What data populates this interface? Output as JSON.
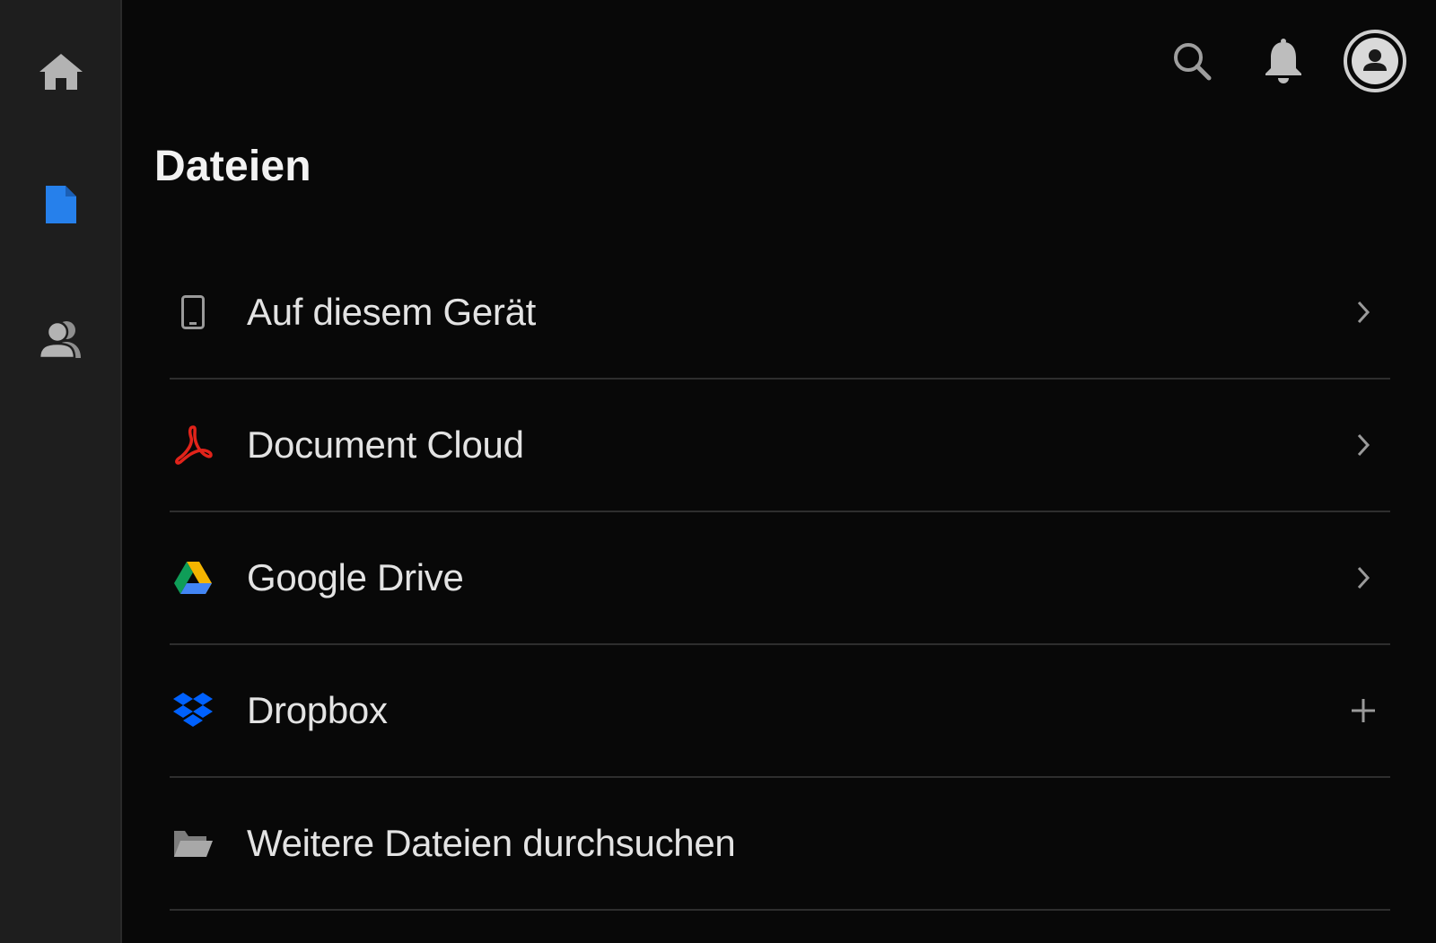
{
  "header": {
    "title": "Dateien",
    "icons": [
      "search-icon",
      "bell-icon",
      "account-icon"
    ]
  },
  "sidebar": {
    "items": [
      {
        "id": "home",
        "icon": "home-icon",
        "active": false
      },
      {
        "id": "files",
        "icon": "document-icon",
        "active": true
      },
      {
        "id": "shared",
        "icon": "people-icon",
        "active": false
      }
    ],
    "active_color": "#2680eb",
    "inactive_color": "#b3b3b3"
  },
  "locations": [
    {
      "label": "Auf diesem Gerät",
      "icon": "phone-icon",
      "action": "chevron-right-icon"
    },
    {
      "label": "Document Cloud",
      "icon": "acrobat-icon",
      "action": "chevron-right-icon"
    },
    {
      "label": "Google Drive",
      "icon": "google-drive-icon",
      "action": "chevron-right-icon"
    },
    {
      "label": "Dropbox",
      "icon": "dropbox-icon",
      "action": "plus-icon"
    },
    {
      "label": "Weitere Dateien durchsuchen",
      "icon": "folder-open-icon",
      "action": ""
    }
  ],
  "colors": {
    "background": "#080808",
    "sidebar": "#1e1e1e",
    "acrobat_red": "#e2231a",
    "dropbox_blue": "#0061fe"
  }
}
